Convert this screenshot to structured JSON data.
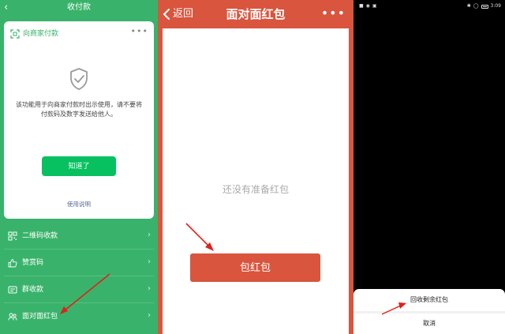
{
  "panel_pay": {
    "title": "收付款",
    "card": {
      "header": "向商家付款",
      "notice": "该功能用于向商家付款时出示使用，请不要将付款码及数字发送给他人。",
      "ok_button": "知道了",
      "help_link": "使用说明"
    },
    "menu": [
      {
        "label": "二维码收款",
        "icon": "qrcode-icon"
      },
      {
        "label": "赞赏码",
        "icon": "thumbs-up-icon"
      },
      {
        "label": "群收款",
        "icon": "group-icon"
      },
      {
        "label": "面对面红包",
        "icon": "red-envelope-icon"
      }
    ]
  },
  "panel_redpacket": {
    "back_label": "返回",
    "title": "面对面红包",
    "empty_text": "还没有准备红包",
    "wrap_button": "包红包"
  },
  "panel_sheet": {
    "status_time": "3:09",
    "recall_action": "回收剩余红包",
    "cancel_action": "取消"
  },
  "colors": {
    "wechat_green": "#39b36b",
    "button_green": "#07c160",
    "red_packet": "#d9553e",
    "arrow_red": "#e0201a"
  }
}
